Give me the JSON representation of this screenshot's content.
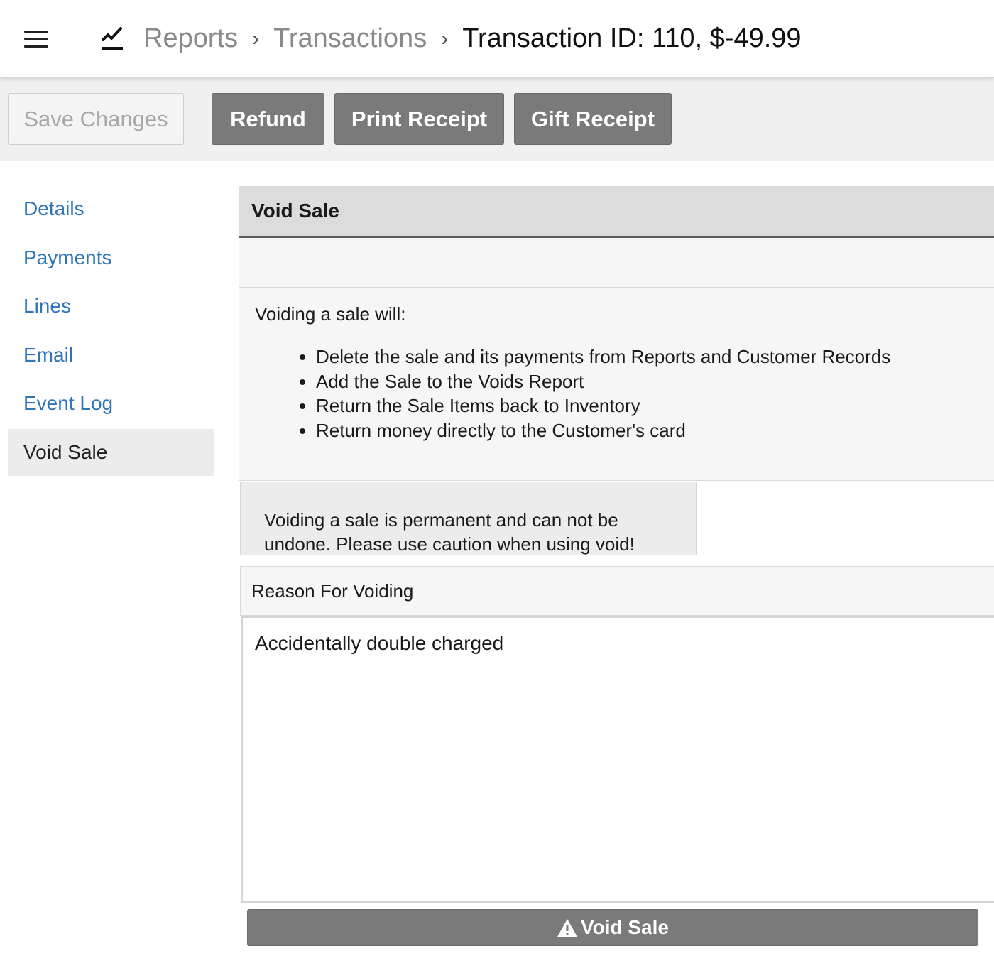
{
  "header": {
    "breadcrumb": {
      "reports": "Reports",
      "transactions": "Transactions",
      "current": "Transaction ID: 110, $-49.99"
    },
    "separator": "›"
  },
  "toolbar": {
    "save_label": "Save Changes",
    "refund_label": "Refund",
    "print_receipt_label": "Print Receipt",
    "gift_receipt_label": "Gift Receipt"
  },
  "sidebar": {
    "items": [
      {
        "label": "Details",
        "active": false
      },
      {
        "label": "Payments",
        "active": false
      },
      {
        "label": "Lines",
        "active": false
      },
      {
        "label": "Email",
        "active": false
      },
      {
        "label": "Event Log",
        "active": false
      },
      {
        "label": "Void Sale",
        "active": true
      }
    ]
  },
  "main": {
    "title": "Void Sale",
    "intro": "Voiding a sale will:",
    "effects": [
      "Delete the sale and its payments from Reports and Customer Records",
      "Add the Sale to the Voids Report",
      "Return the Sale Items back to Inventory",
      "Return money directly to the Customer's card"
    ],
    "warning_line1": "Voiding a sale is permanent and can not be",
    "warning_line2": "undone. Please use caution when using void!",
    "reason_label": "Reason For Voiding",
    "reason_value": "Accidentally double charged",
    "void_button_label": "Void Sale"
  },
  "colors": {
    "link": "#2f75b7",
    "button_gray": "#7a7a7a",
    "toolbar_bg": "#f0f0f0"
  },
  "icons": {
    "menu": "hamburger-icon",
    "reports": "line-chart-icon",
    "void": "warning-triangle-icon"
  }
}
